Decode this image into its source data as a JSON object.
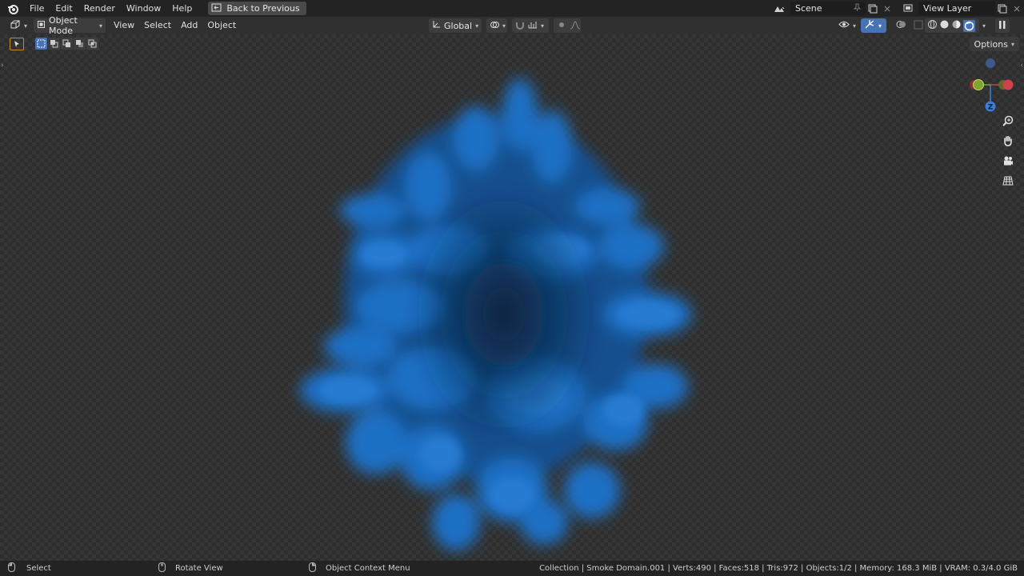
{
  "topbar": {
    "menus": [
      "File",
      "Edit",
      "Render",
      "Window",
      "Help"
    ],
    "back_label": "Back to Previous",
    "scene_value": "Scene",
    "view_layer_value": "View Layer"
  },
  "header": {
    "mode_label": "Object Mode",
    "menus": [
      "View",
      "Select",
      "Add",
      "Object"
    ],
    "transform_orientation": "Global"
  },
  "viewport": {
    "options_label": "Options",
    "gizmo": {
      "z_label": "Z"
    }
  },
  "statusbar": {
    "select_label": "Select",
    "rotate_label": "Rotate View",
    "context_label": "Object Context Menu",
    "stats": "Collection | Smoke Domain.001 | Verts:490 | Faces:518 | Tris:972 | Objects:1/2 | Memory: 168.3 MiB | VRAM: 0.3/4.0 GiB"
  },
  "colors": {
    "accent": "#4772b3",
    "smoke": "#1f6fc4",
    "axis_x": "#d0414d",
    "axis_y": "#7fa52c",
    "axis_z": "#3a7ed8"
  }
}
